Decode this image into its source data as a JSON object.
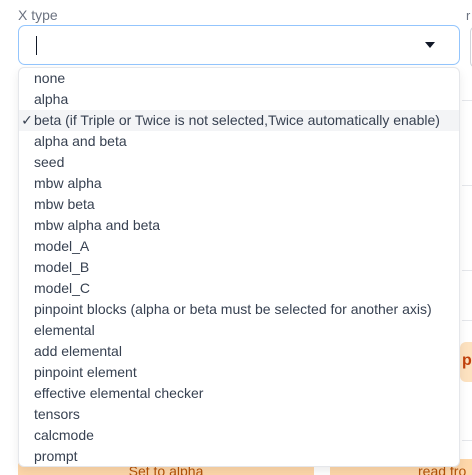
{
  "field": {
    "label": "X type",
    "value": ""
  },
  "right_field": {
    "label": "r"
  },
  "dropdown": {
    "selected_index": 2,
    "check_mark": "✓",
    "options": [
      "none",
      "alpha",
      "beta (if Triple or Twice is not selected,Twice automatically enable)",
      "alpha and beta",
      "seed",
      "mbw alpha",
      "mbw beta",
      "mbw alpha and beta",
      "model_A",
      "model_B",
      "model_C",
      "pinpoint blocks (alpha or beta must be selected for another axis)",
      "elemental",
      "add elemental",
      "pinpoint element",
      "effective elemental checker",
      "tensors",
      "calcmode",
      "prompt"
    ]
  },
  "buttons": {
    "set_to_alpha": "Set to alpha",
    "read_from": "read fro",
    "right_peek": "p"
  },
  "colors": {
    "focus_border": "#93c5fd",
    "button_bg": "#fed7aa",
    "button_text": "#b45309",
    "selected_option_bg": "#f3f4f6"
  },
  "icons": {
    "dropdown": "chevron-down-icon",
    "selected": "checkmark-icon"
  }
}
